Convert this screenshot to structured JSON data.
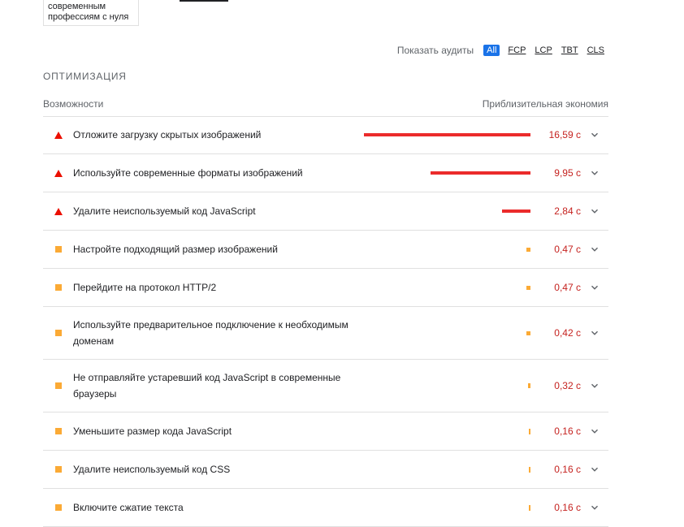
{
  "top_card": {
    "line1": "современным",
    "line2": "профессиям с нуля"
  },
  "filter": {
    "label": "Показать аудиты",
    "chips": [
      "All",
      "FCP",
      "LCP",
      "TBT",
      "CLS"
    ],
    "active": "All"
  },
  "section": {
    "title": "ОПТИМИЗАЦИЯ",
    "col_left": "Возможности",
    "col_right": "Приблизительная экономия"
  },
  "colors": {
    "fail": "#eb0f00",
    "average": "#fbaa35",
    "accent": "#1a73e8"
  },
  "audits": [
    {
      "title": "Отложите загрузку скрытых изображений",
      "value": "16,59 с",
      "status": "fail",
      "savings_s": 16.59
    },
    {
      "title": "Используйте современные форматы изображений",
      "value": "9,95 с",
      "status": "fail",
      "savings_s": 9.95
    },
    {
      "title": "Удалите неиспользуемый код JavaScript",
      "value": "2,84 с",
      "status": "fail",
      "savings_s": 2.84
    },
    {
      "title": "Настройте подходящий размер изображений",
      "value": "0,47 с",
      "status": "average",
      "savings_s": 0.47
    },
    {
      "title": "Перейдите на протокол HTTP/2",
      "value": "0,47 с",
      "status": "average",
      "savings_s": 0.47
    },
    {
      "title": "Используйте предварительное подключение к необходимым доменам",
      "value": "0,42 с",
      "status": "average",
      "savings_s": 0.42
    },
    {
      "title": "Не отправляйте устаревший код JavaScript в современные браузеры",
      "value": "0,32 с",
      "status": "average",
      "savings_s": 0.32
    },
    {
      "title": "Уменьшите размер кода JavaScript",
      "value": "0,16 с",
      "status": "average",
      "savings_s": 0.16
    },
    {
      "title": "Удалите неиспользуемый код CSS",
      "value": "0,16 с",
      "status": "average",
      "savings_s": 0.16
    },
    {
      "title": "Включите сжатие текста",
      "value": "0,16 с",
      "status": "average",
      "savings_s": 0.16
    }
  ]
}
